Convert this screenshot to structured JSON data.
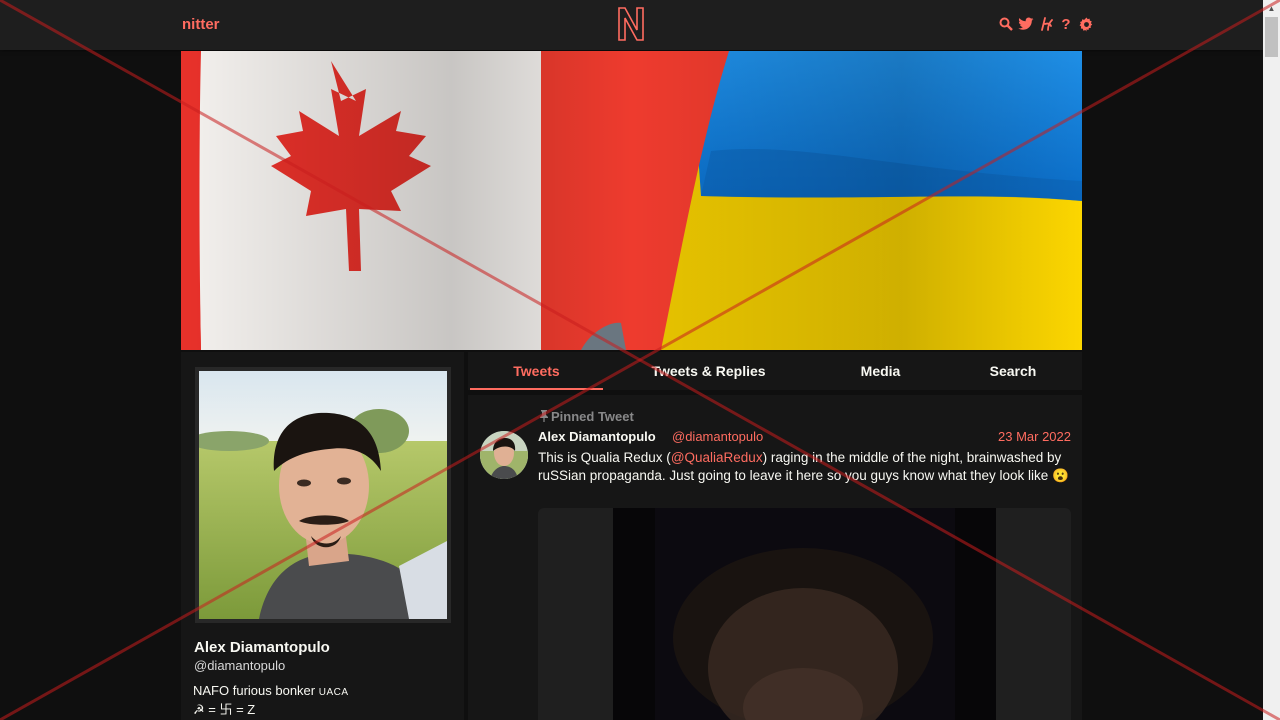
{
  "nav": {
    "brand": "nitter",
    "icons": [
      "search-icon",
      "twitter-bird-icon",
      "rss-icon",
      "help-icon",
      "gear-icon"
    ],
    "logo": "N"
  },
  "profile": {
    "fullname": "Alex Diamantopulo",
    "username": "@diamantopulo",
    "bio_line1": "NAFO furious bonker",
    "bio_badge": "UACA",
    "bio_line2": "☭ = 卐 = Z"
  },
  "tabs": [
    {
      "label": "Tweets",
      "active": true
    },
    {
      "label": "Tweets & Replies",
      "active": false
    },
    {
      "label": "Media",
      "active": false
    },
    {
      "label": "Search",
      "active": false
    }
  ],
  "tweet": {
    "pinned_label": "Pinned Tweet",
    "pin_icon": "pin-icon",
    "author": "Alex Diamantopulo",
    "handle": "@diamantopulo",
    "date": "23 Mar 2022",
    "text_before": "This is Qualia Redux (",
    "mention": "@QualiaRedux",
    "text_after": ") raging in the middle of the night, brainwashed by ruSSian propaganda. Just going to leave it here so you guys know what they look like",
    "emoji": "😮"
  },
  "colors": {
    "accent": "#ff6c60",
    "background": "#0f0f0f",
    "panel": "#161616",
    "nav": "#1e1e1e"
  }
}
